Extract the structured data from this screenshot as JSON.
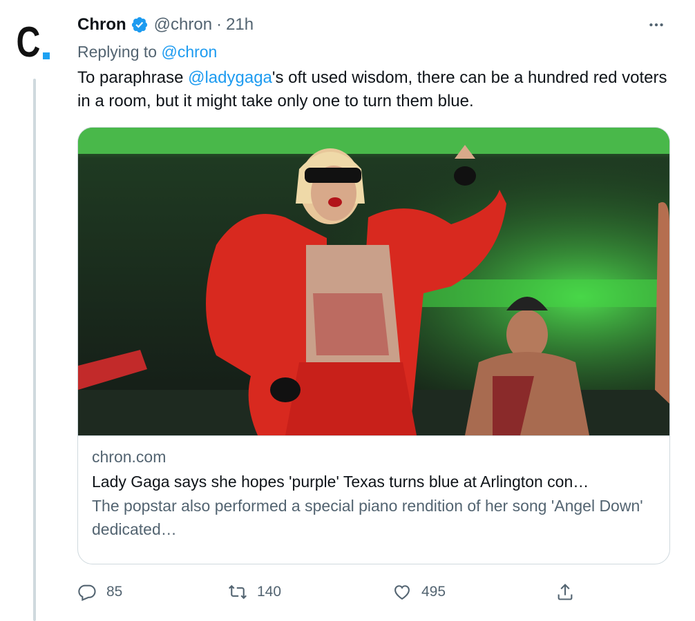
{
  "tweet": {
    "author_name": "Chron",
    "author_handle": "@chron",
    "separator": "·",
    "time": "21h",
    "avatar_letter": "C",
    "replying_prefix": "Replying to",
    "replying_to": "@chron",
    "text_before": "To paraphrase ",
    "text_mention": "@ladygaga",
    "text_after": "'s oft used wisdom, there can be a hundred red voters in a room, but it might take only one to turn them blue."
  },
  "card": {
    "domain": "chron.com",
    "title": "Lady Gaga says she hopes 'purple' Texas turns blue at Arlington con…",
    "description": "The popstar also performed a special piano rendition of her song 'Angel Down' dedicated…"
  },
  "actions": {
    "replies": "85",
    "retweets": "140",
    "likes": "495"
  },
  "colors": {
    "accent": "#1d9bf0",
    "secondary_text": "#536471",
    "border": "#cfd9de",
    "logo_dot": "#1da1f2"
  },
  "icons": [
    "verified-badge-icon",
    "more-icon",
    "reply-icon",
    "retweet-icon",
    "like-icon",
    "share-icon"
  ]
}
